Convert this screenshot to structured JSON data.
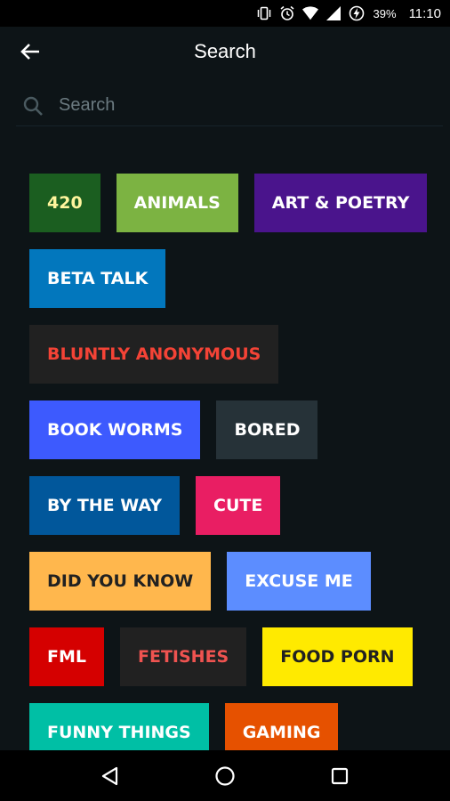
{
  "status_bar": {
    "battery_percent": "39%",
    "time": "11:10",
    "icons": [
      "vibrate-icon",
      "alarm-icon",
      "wifi-icon",
      "signal-icon",
      "battery-charging-icon"
    ]
  },
  "toolbar": {
    "title": "Search",
    "back_icon": "arrow-back-icon"
  },
  "search": {
    "placeholder": "Search",
    "value": ""
  },
  "tags": [
    {
      "label": "420",
      "bg": "#1b5e20",
      "fg": "#fff59d"
    },
    {
      "label": "ANIMALS",
      "bg": "#7cb342",
      "fg": "#ffffff"
    },
    {
      "label": "ART & POETRY",
      "bg": "#4a148c",
      "fg": "#ffffff"
    },
    {
      "label": "BETA TALK",
      "bg": "#0277bd",
      "fg": "#ffffff"
    },
    {
      "label": "BLUNTLY ANONYMOUS",
      "bg": "#212121",
      "fg": "#f44336"
    },
    {
      "label": "BOOK WORMS",
      "bg": "#3d5afe",
      "fg": "#ffffff"
    },
    {
      "label": "BORED",
      "bg": "#263238",
      "fg": "#ffffff"
    },
    {
      "label": "BY THE WAY",
      "bg": "#01579b",
      "fg": "#ffffff"
    },
    {
      "label": "CUTE",
      "bg": "#e91e63",
      "fg": "#ffffff"
    },
    {
      "label": "DID YOU KNOW",
      "bg": "#ffb74d",
      "fg": "#212121"
    },
    {
      "label": "EXCUSE ME",
      "bg": "#5c8dff",
      "fg": "#ffffff"
    },
    {
      "label": "FML",
      "bg": "#d50000",
      "fg": "#ffffff"
    },
    {
      "label": "FETISHES",
      "bg": "#212121",
      "fg": "#ef5350"
    },
    {
      "label": "FOOD PORN",
      "bg": "#ffea00",
      "fg": "#212121"
    },
    {
      "label": "FUNNY THINGS",
      "bg": "#00bfa5",
      "fg": "#ffffff"
    },
    {
      "label": "GAMING",
      "bg": "#e65100",
      "fg": "#ffffff"
    }
  ],
  "nav_bar": {
    "icons": [
      "back-triangle-icon",
      "home-circle-icon",
      "recents-square-icon"
    ]
  }
}
